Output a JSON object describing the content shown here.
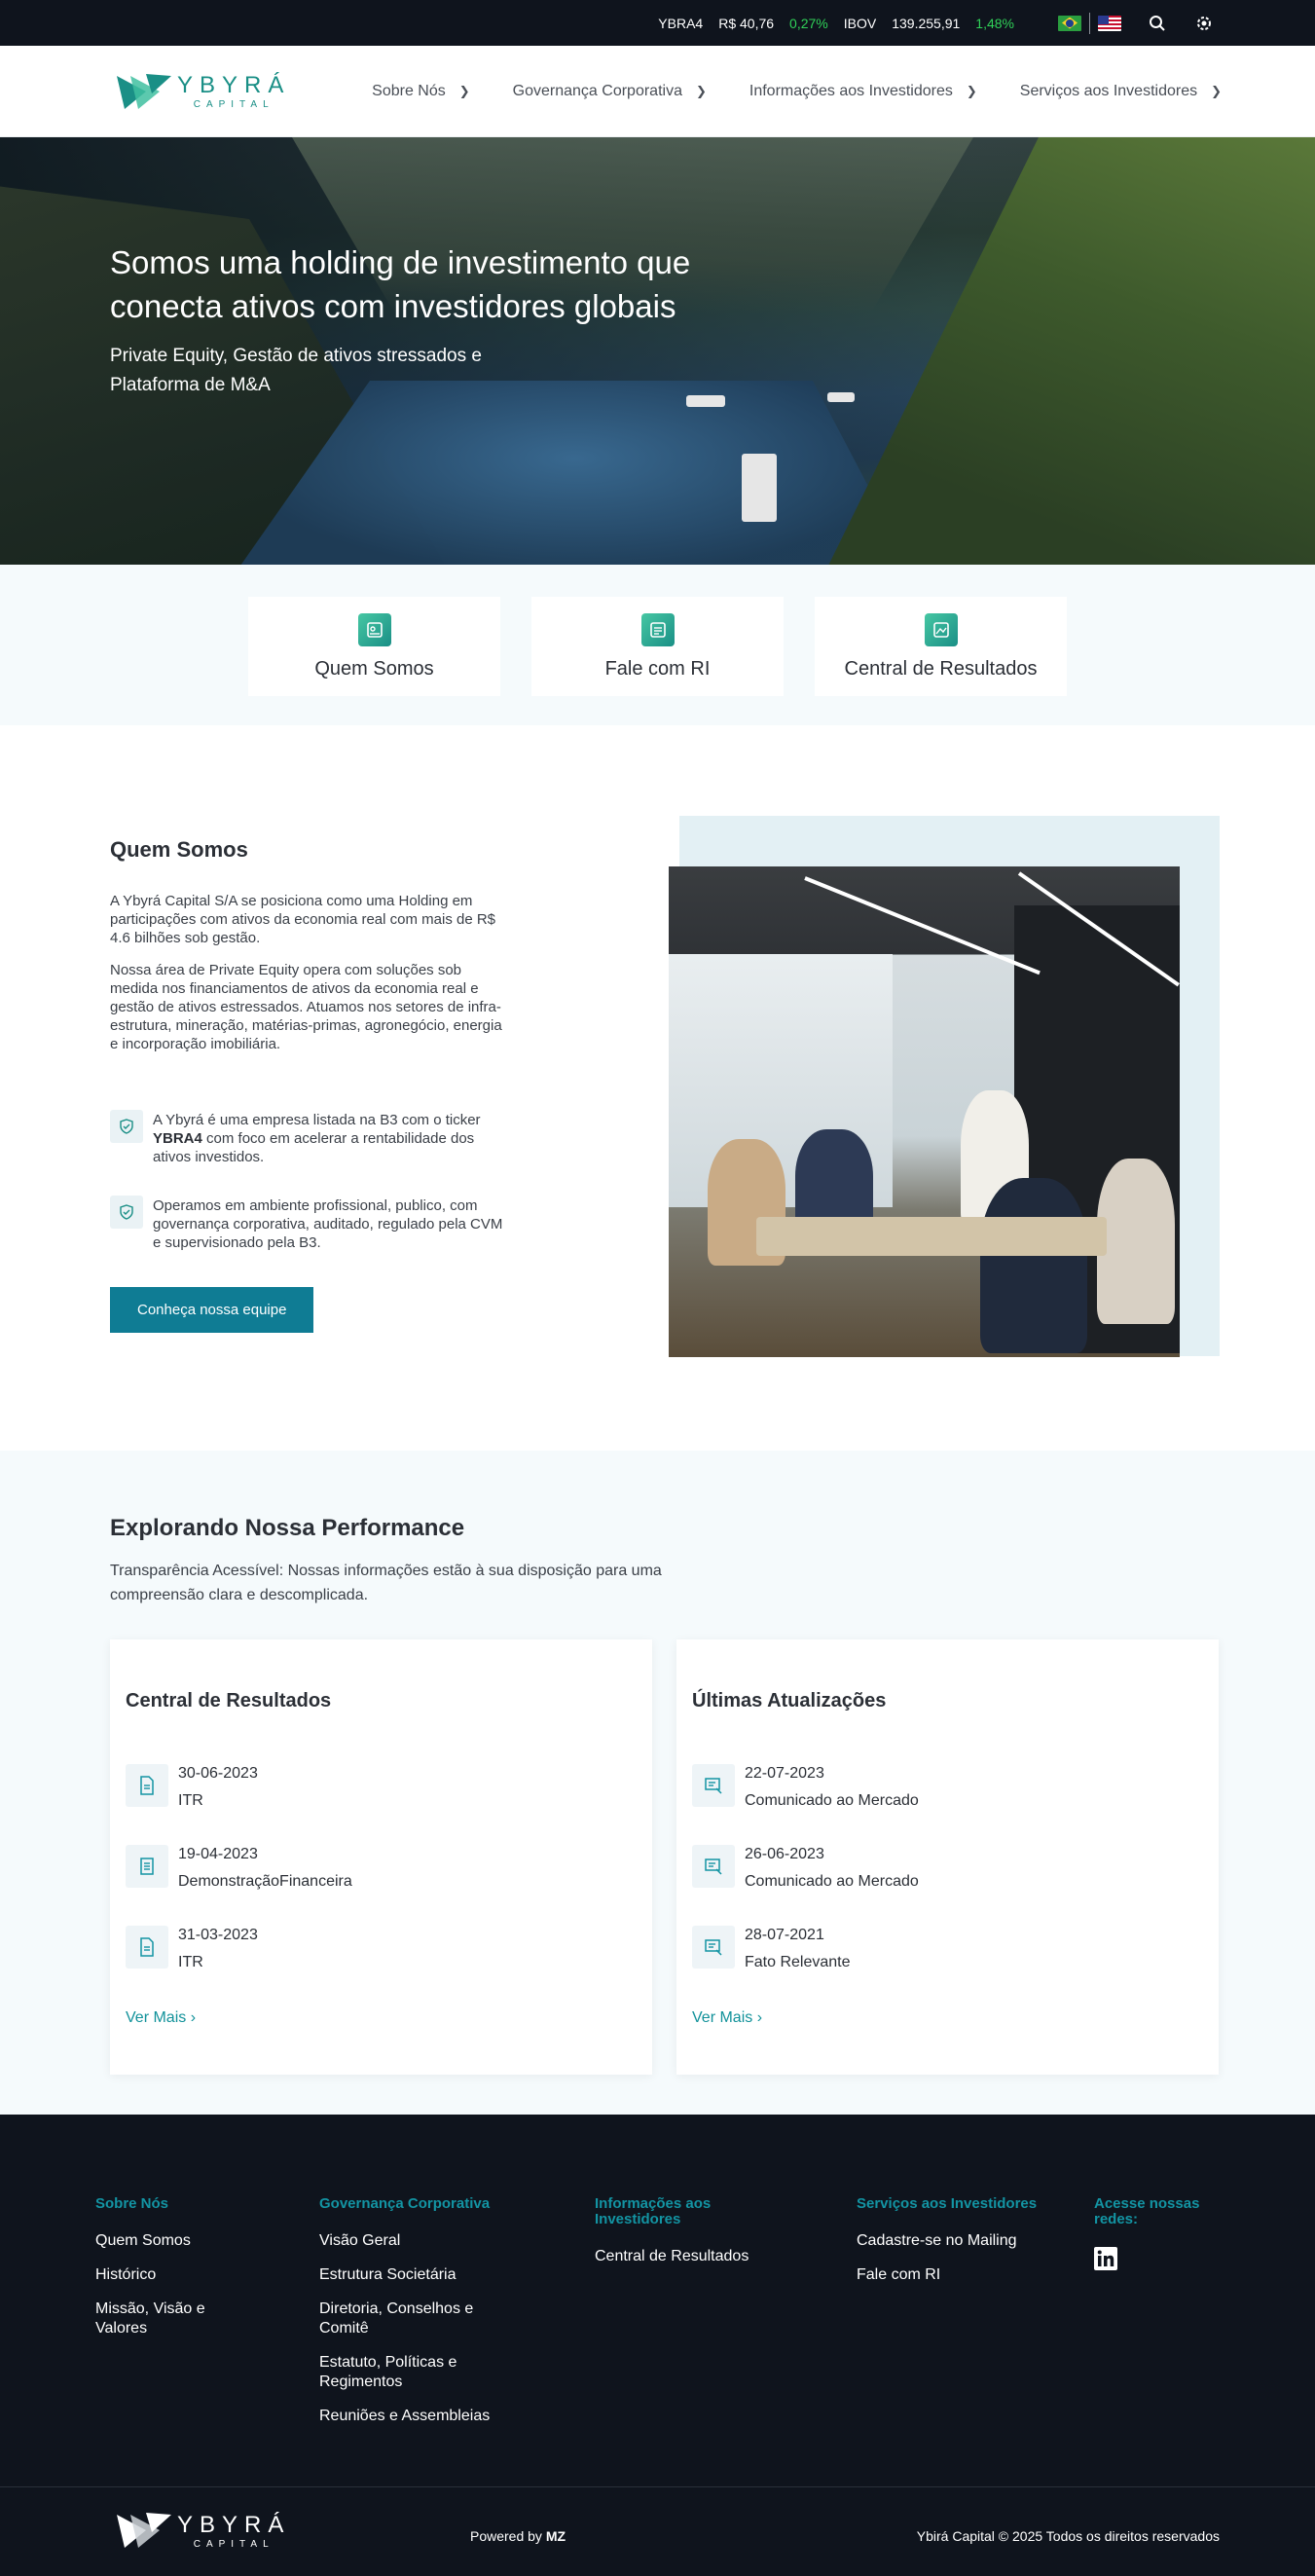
{
  "ticker": {
    "symbol": "YBRA4",
    "price": "R$ 40,76",
    "change": "0,27%",
    "index": "IBOV",
    "index_value": "139.255,91",
    "index_change": "1,48%"
  },
  "header": {
    "logo_name": "YBYRÁ",
    "logo_sub": "CAPITAL",
    "nav": [
      "Sobre Nós",
      "Governança Corporativa",
      "Informações aos Investidores",
      "Serviços aos Investidores"
    ]
  },
  "hero": {
    "title": "Somos uma holding de investimento que conecta ativos com investidores globais",
    "subtitle": "Private Equity, Gestão de ativos stressados e Plataforma de M&A"
  },
  "quick_links": [
    "Quem Somos",
    "Fale com RI",
    "Central de Resultados"
  ],
  "about": {
    "title": "Quem Somos",
    "paragraph1": "A Ybyrá Capital S/A se posiciona como uma Holding em participações com ativos da economia real com mais de R$ 4.6 bilhões sob gestão.",
    "paragraph2": "Nossa área de Private Equity opera com soluções sob medida nos financiamentos de ativos da economia real e gestão de ativos estressados. Atuamos nos setores de infra-estrutura, mineração, matérias-primas, agronegócio, energia e incorporação imobiliária.",
    "feature1_pre": "A Ybyrá é uma empresa listada na B3 com o ticker ",
    "feature1_ticker": "YBRA4",
    "feature1_post": " com foco em acelerar a rentabilidade dos ativos investidos.",
    "feature2": "Operamos em ambiente profissional, publico, com governança corporativa, auditado, regulado pela CVM e supervisionado pela B3.",
    "button": "Conheça nossa equipe"
  },
  "performance": {
    "title": "Explorando Nossa Performance",
    "subtitle": "Transparência Acessível: Nossas informações estão à sua disposição para uma compreensão clara e descomplicada.",
    "results_title_pre": "Central de ",
    "results_title_bold": "Resultados",
    "results": [
      {
        "date": "30-06-2023",
        "label": "ITR"
      },
      {
        "date": "19-04-2023",
        "label": "DemonstraçãoFinanceira"
      },
      {
        "date": "31-03-2023",
        "label": "ITR"
      }
    ],
    "updates_title_pre": "Últimas ",
    "updates_title_bold": "Atualizações",
    "updates": [
      {
        "date": "22-07-2023",
        "label": "Comunicado ao Mercado"
      },
      {
        "date": "26-06-2023",
        "label": "Comunicado ao Mercado"
      },
      {
        "date": "28-07-2021",
        "label": "Fato Relevante"
      }
    ],
    "see_more": "Ver Mais"
  },
  "footer": {
    "col1_title": "Sobre Nós",
    "col1_links": [
      "Quem Somos",
      "Histórico",
      "Missão, Visão e Valores"
    ],
    "col2_title": "Governança Corporativa",
    "col2_links": [
      "Visão Geral",
      "Estrutura Societária",
      "Diretoria, Conselhos e Comitê",
      "Estatuto, Políticas e Regimentos",
      "Reuniões e Assembleias"
    ],
    "col3_title": "Informações aos Investidores",
    "col3_links": [
      "Central de Resultados"
    ],
    "col4_title": "Serviços aos Investidores",
    "col4_links": [
      "Cadastre-se no Mailing",
      "Fale com RI"
    ],
    "col5_title": "Acesse nossas redes:",
    "powered_pre": "Powered by ",
    "powered_brand": "MZ",
    "copyright": "Ybirá Capital © 2025 Todos os direitos reservados"
  },
  "colors": {
    "accent": "#0f7c94",
    "brand": "#1a8f86",
    "positive": "#30d158",
    "footer_bg": "#0f141d"
  }
}
